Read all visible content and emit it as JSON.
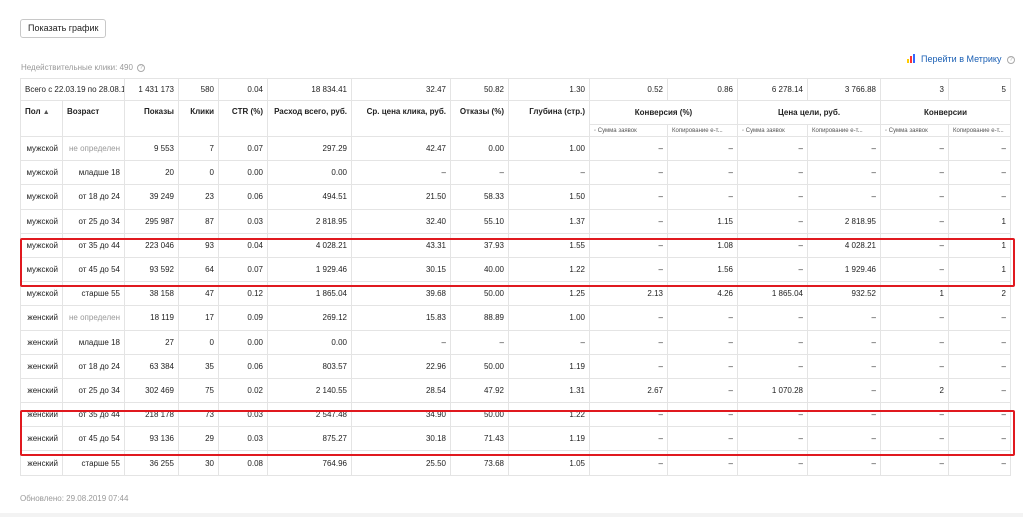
{
  "toolbar": {
    "show_chart_label": "Показать график"
  },
  "invalid_clicks": {
    "label": "Недействительные клики: 490",
    "help_glyph": "?"
  },
  "metrika_link": {
    "label": "Перейти в Метрику",
    "help_glyph": "?",
    "icon": "bar-chart-icon"
  },
  "totals": {
    "period": "Всего с 22.03.19 по 28.08.19",
    "values": [
      "1 431 173",
      "580",
      "0.04",
      "18 834.41",
      "32.47",
      "50.82",
      "1.30",
      "0.52",
      "0.86",
      "6 278.14",
      "3 766.88",
      "3",
      "5"
    ]
  },
  "headers": {
    "sex": "Пол",
    "sort_glyph": "▲",
    "age": "Возраст",
    "impressions": "Показы",
    "clicks": "Клики",
    "ctr": "CTR (%)",
    "spend": "Расход всего, руб.",
    "cpc": "Ср. цена клика, руб.",
    "bounce": "Отказы (%)",
    "depth": "Глубина (стр.)",
    "conversion_pct": "Конверсия (%)",
    "goal_price": "Цена цели, руб.",
    "conversions": "Конверсии",
    "sub_sum": "◦ Сумма заявок",
    "sub_copy": "Копирование е-т..."
  },
  "rows": [
    {
      "sex": "мужской",
      "age": "не определен",
      "age_muted": true,
      "cells": [
        "9 553",
        "7",
        "0.07",
        "297.29",
        "42.47",
        "0.00",
        "1.00",
        "–",
        "–",
        "–",
        "–",
        "–",
        "–"
      ]
    },
    {
      "sex": "мужской",
      "age": "младше 18",
      "age_muted": false,
      "cells": [
        "20",
        "0",
        "0.00",
        "0.00",
        "–",
        "–",
        "–",
        "–",
        "–",
        "–",
        "–",
        "–",
        "–"
      ]
    },
    {
      "sex": "мужской",
      "age": "от 18 до 24",
      "age_muted": false,
      "cells": [
        "39 249",
        "23",
        "0.06",
        "494.51",
        "21.50",
        "58.33",
        "1.50",
        "–",
        "–",
        "–",
        "–",
        "–",
        "–"
      ]
    },
    {
      "sex": "мужской",
      "age": "от 25 до 34",
      "age_muted": false,
      "cells": [
        "295 987",
        "87",
        "0.03",
        "2 818.95",
        "32.40",
        "55.10",
        "1.37",
        "–",
        "1.15",
        "–",
        "2 818.95",
        "–",
        "1"
      ]
    },
    {
      "sex": "мужской",
      "age": "от 35 до 44",
      "age_muted": false,
      "cells": [
        "223 046",
        "93",
        "0.04",
        "4 028.21",
        "43.31",
        "37.93",
        "1.55",
        "–",
        "1.08",
        "–",
        "4 028.21",
        "–",
        "1"
      ]
    },
    {
      "sex": "мужской",
      "age": "от 45 до 54",
      "age_muted": false,
      "cells": [
        "93 592",
        "64",
        "0.07",
        "1 929.46",
        "30.15",
        "40.00",
        "1.22",
        "–",
        "1.56",
        "–",
        "1 929.46",
        "–",
        "1"
      ]
    },
    {
      "sex": "мужской",
      "age": "старше 55",
      "age_muted": false,
      "cells": [
        "38 158",
        "47",
        "0.12",
        "1 865.04",
        "39.68",
        "50.00",
        "1.25",
        "2.13",
        "4.26",
        "1 865.04",
        "932.52",
        "1",
        "2"
      ]
    },
    {
      "sex": "женский",
      "age": "не определен",
      "age_muted": true,
      "cells": [
        "18 119",
        "17",
        "0.09",
        "269.12",
        "15.83",
        "88.89",
        "1.00",
        "–",
        "–",
        "–",
        "–",
        "–",
        "–"
      ]
    },
    {
      "sex": "женский",
      "age": "младше 18",
      "age_muted": false,
      "cells": [
        "27",
        "0",
        "0.00",
        "0.00",
        "–",
        "–",
        "–",
        "–",
        "–",
        "–",
        "–",
        "–",
        "–"
      ]
    },
    {
      "sex": "женский",
      "age": "от 18 до 24",
      "age_muted": false,
      "cells": [
        "63 384",
        "35",
        "0.06",
        "803.57",
        "22.96",
        "50.00",
        "1.19",
        "–",
        "–",
        "–",
        "–",
        "–",
        "–"
      ]
    },
    {
      "sex": "женский",
      "age": "от 25 до 34",
      "age_muted": false,
      "cells": [
        "302 469",
        "75",
        "0.02",
        "2 140.55",
        "28.54",
        "47.92",
        "1.31",
        "2.67",
        "–",
        "1 070.28",
        "–",
        "2",
        "–"
      ]
    },
    {
      "sex": "женский",
      "age": "от 35 до 44",
      "age_muted": false,
      "cells": [
        "218 178",
        "73",
        "0.03",
        "2 547.48",
        "34.90",
        "50.00",
        "1.22",
        "–",
        "–",
        "–",
        "–",
        "–",
        "–"
      ]
    },
    {
      "sex": "женский",
      "age": "от 45 до 54",
      "age_muted": false,
      "cells": [
        "93 136",
        "29",
        "0.03",
        "875.27",
        "30.18",
        "71.43",
        "1.19",
        "–",
        "–",
        "–",
        "–",
        "–",
        "–"
      ]
    },
    {
      "sex": "женский",
      "age": "старше 55",
      "age_muted": false,
      "cells": [
        "36 255",
        "30",
        "0.08",
        "764.96",
        "25.50",
        "73.68",
        "1.05",
        "–",
        "–",
        "–",
        "–",
        "–",
        "–"
      ]
    }
  ],
  "footer": {
    "updated": "Обновлено: 29.08.2019 07:44"
  },
  "colors": {
    "link": "#1a5fb4",
    "highlight": "#e0191f",
    "border": "#e4e4e4",
    "muted": "#999999",
    "metrika_bars": [
      "#ffcc00",
      "#ff3333",
      "#3366ff"
    ]
  }
}
